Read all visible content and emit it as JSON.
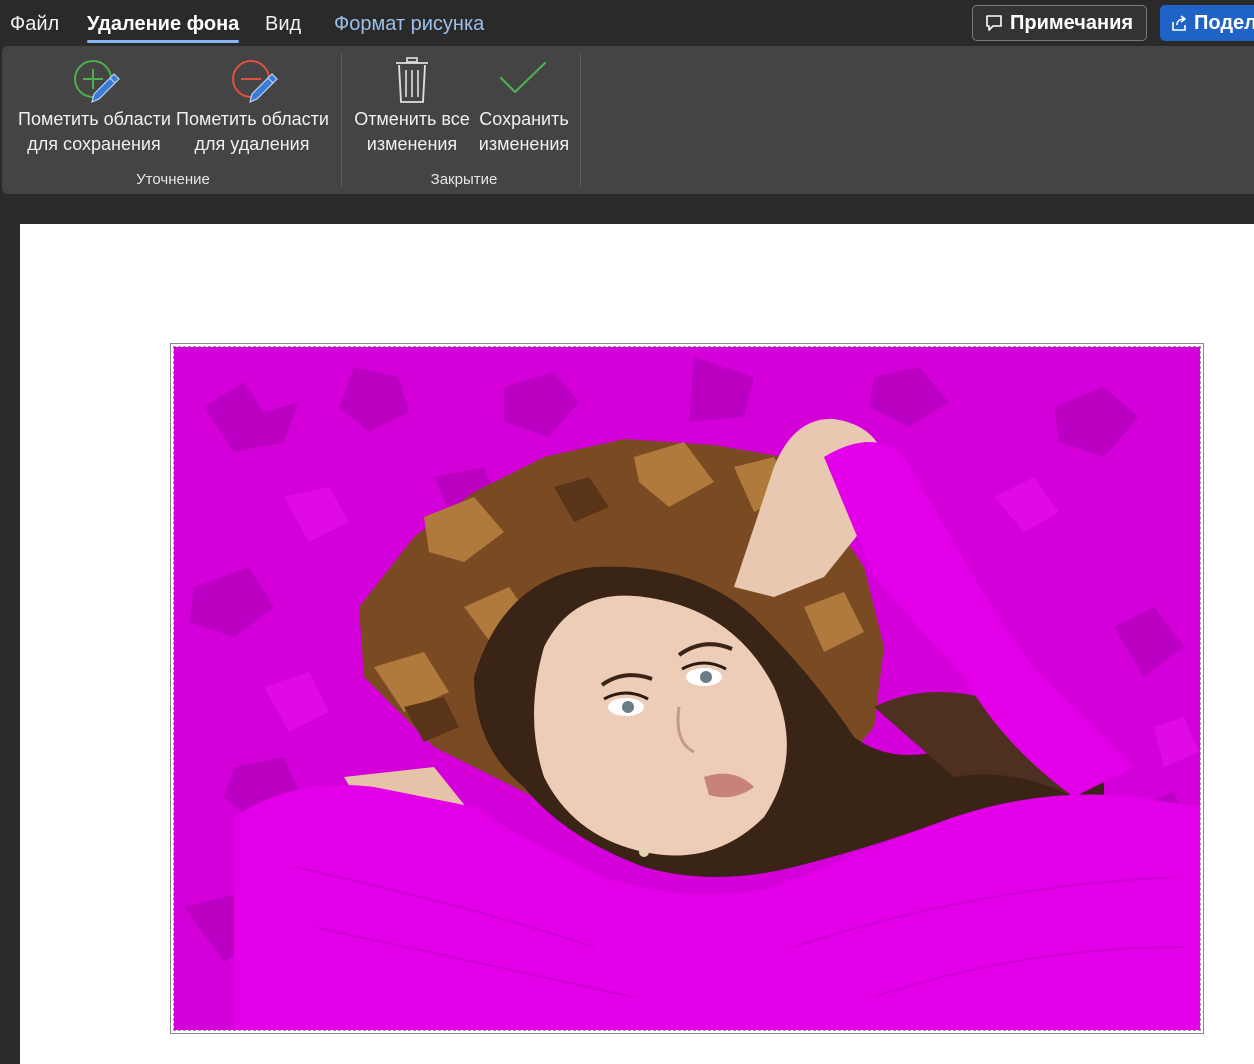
{
  "menu": {
    "tabs": [
      {
        "label": "Файл"
      },
      {
        "label": "Удаление фона"
      },
      {
        "label": "Вид"
      },
      {
        "label": "Формат рисунка"
      }
    ],
    "notes_label": "Примечания",
    "share_label": "Подел"
  },
  "ribbon": {
    "mark_keep_label": "Пометить области\nдля сохранения",
    "mark_keep_line1": "Пометить области",
    "mark_keep_line2": "для сохранения",
    "mark_remove_line1": "Пометить области",
    "mark_remove_line2": "для удаления",
    "discard_line1": "Отменить все",
    "discard_line2": "изменения",
    "save_line1": "Сохранить",
    "save_line2": "изменения",
    "group_refine": "Уточнение",
    "group_close": "Закрытие"
  },
  "colors": {
    "removal_overlay": "#e100e6",
    "active_tab_underline": "#8ab4f8",
    "share_button": "#1f63c7",
    "keep_icon": "#4caf50",
    "remove_icon": "#e05040"
  },
  "icons": [
    "mark-keep-icon",
    "mark-remove-icon",
    "trash-icon",
    "checkmark-icon",
    "comment-icon",
    "share-icon"
  ]
}
